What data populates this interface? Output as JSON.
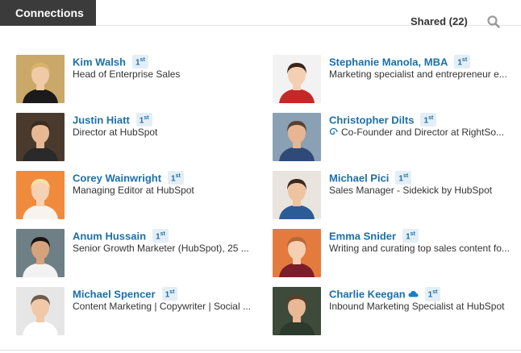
{
  "header": {
    "tab_label": "Connections",
    "shared_label": "Shared (22)"
  },
  "connections": [
    {
      "name": "Kim Walsh",
      "degree": "1",
      "degree_suffix": "st",
      "title": "Head of Enterprise Sales",
      "photo_bg": "#caa86a",
      "skin": "#f0c9a6",
      "hair": "#d9b36a",
      "shirt": "#1a1a1a"
    },
    {
      "name": "Stephanie Manola, MBA",
      "degree": "1",
      "degree_suffix": "st",
      "title": "Marketing specialist and entrepreneur e...",
      "photo_bg": "#f2f2f2",
      "skin": "#f3cfb3",
      "hair": "#3a2418",
      "shirt": "#c62828"
    },
    {
      "name": "Justin Hiatt",
      "degree": "1",
      "degree_suffix": "st",
      "title": "Director at HubSpot",
      "photo_bg": "#4a3a2e",
      "skin": "#e8b894",
      "hair": "#3b2a1e",
      "shirt": "#2a2a2a"
    },
    {
      "name": "Christopher Dilts",
      "degree": "1",
      "degree_suffix": "st",
      "title": "Co-Founder and Director at RightSo...",
      "photo_bg": "#8aa0b4",
      "skin": "#e6b592",
      "hair": "#5b4030",
      "shirt": "#2f4a78"
    },
    {
      "name": "Corey Wainwright",
      "degree": "1",
      "degree_suffix": "st",
      "title": "Managing Editor at HubSpot",
      "photo_bg": "#f08a3c",
      "skin": "#f6d2b4",
      "hair": "#f4e0a8",
      "shirt": "#f7f3ee"
    },
    {
      "name": "Michael Pici",
      "degree": "1",
      "degree_suffix": "st",
      "title": "Sales Manager - Sidekick by HubSpot",
      "photo_bg": "#e9e4de",
      "skin": "#eec3a0",
      "hair": "#3a2a1e",
      "shirt": "#2c5c96"
    },
    {
      "name": "Anum Hussain",
      "degree": "1",
      "degree_suffix": "st",
      "title": "Senior Growth Marketer (HubSpot), 25 ...",
      "photo_bg": "#6e7f86",
      "skin": "#d6a27c",
      "hair": "#1d1410",
      "shirt": "#f2f2f2"
    },
    {
      "name": "Emma Snider",
      "degree": "1",
      "degree_suffix": "st",
      "title": "Writing and curating top sales content fo...",
      "photo_bg": "#e37b3f",
      "skin": "#f5cfb2",
      "hair": "#b5673a",
      "shirt": "#7a1e2c"
    },
    {
      "name": "Michael Spencer",
      "degree": "1",
      "degree_suffix": "st",
      "title": "Content Marketing | Copywriter | Social ...",
      "photo_bg": "#e6e6e6",
      "skin": "#f1c9a8",
      "hair": "#6e5a4a",
      "shirt": "#ffffff"
    },
    {
      "name": "Charlie Keegan",
      "degree": "1",
      "degree_suffix": "st",
      "title": "Inbound Marketing Specialist at HubSpot",
      "photo_bg": "#3e4a3a",
      "skin": "#e9b895",
      "hair": "#5a3e2a",
      "shirt": "#2b3a2c"
    }
  ],
  "icons": {
    "search": "search-icon",
    "cloud_badge": "cloud-icon",
    "swirl_badge": "swirl-icon"
  },
  "colors": {
    "link": "#1c6fa9",
    "degree_bg": "#e4eef5",
    "header_tab_bg": "#3b3b3b"
  }
}
